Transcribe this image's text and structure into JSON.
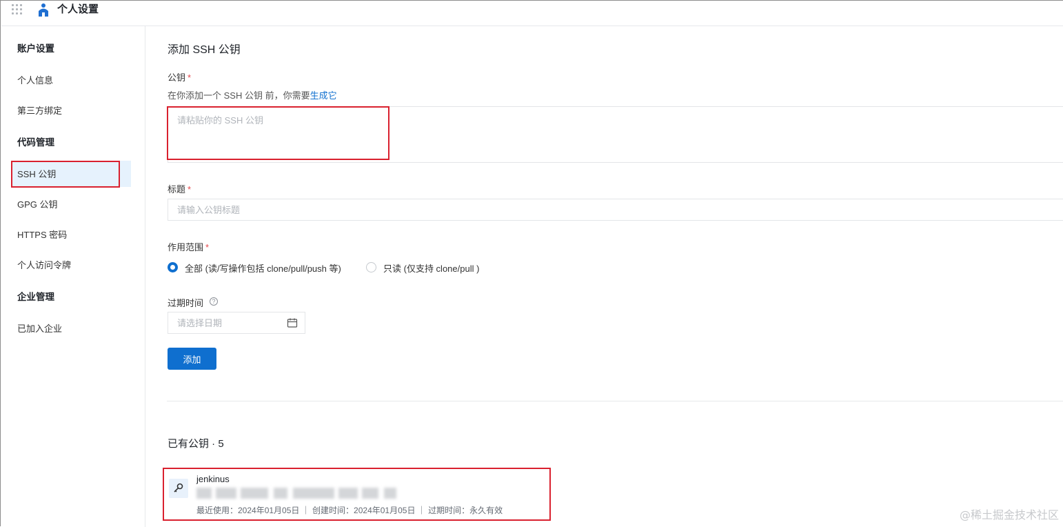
{
  "header": {
    "app_title": "个人设置"
  },
  "sidebar": {
    "groups": [
      {
        "label": "账户设置",
        "items": [
          "个人信息",
          "第三方绑定"
        ]
      },
      {
        "label": "代码管理",
        "items": [
          "SSH 公钥",
          "GPG 公钥",
          "HTTPS 密码",
          "个人访问令牌"
        ]
      },
      {
        "label": "企业管理",
        "items": [
          "已加入企业"
        ]
      }
    ],
    "active_item": "SSH 公钥"
  },
  "form": {
    "title": "添加 SSH 公钥",
    "public_key": {
      "label": "公钥",
      "required_mark": "*",
      "hint_prefix": "在你添加一个 SSH 公钥 前，你需要",
      "hint_link": "生成它",
      "placeholder": "请粘贴你的 SSH 公钥"
    },
    "key_title": {
      "label": "标题",
      "required_mark": "*",
      "placeholder": "请输入公钥标题"
    },
    "scope": {
      "label": "作用范围",
      "required_mark": "*",
      "options": [
        {
          "label": "全部 (读/写操作包括 clone/pull/push 等)",
          "checked": true
        },
        {
          "label": "只读 (仅支持 clone/pull )",
          "checked": false
        }
      ]
    },
    "expiry": {
      "label": "过期时间",
      "help_icon": "question-circle-icon",
      "placeholder": "请选择日期"
    },
    "submit_label": "添加"
  },
  "existing_keys": {
    "title": "已有公钥 · 5",
    "items": [
      {
        "name": "jenkinus",
        "meta": "最近使用：2024年01月05日 ｜ 创建时间：2024年01月05日 ｜ 过期时间：永久有效"
      }
    ]
  },
  "watermark": "@稀土掘金技术社区",
  "colors": {
    "primary": "#0f6fcf",
    "highlight": "#d9202e",
    "active_bg": "#e6f2fd",
    "required": "#e5484d"
  }
}
